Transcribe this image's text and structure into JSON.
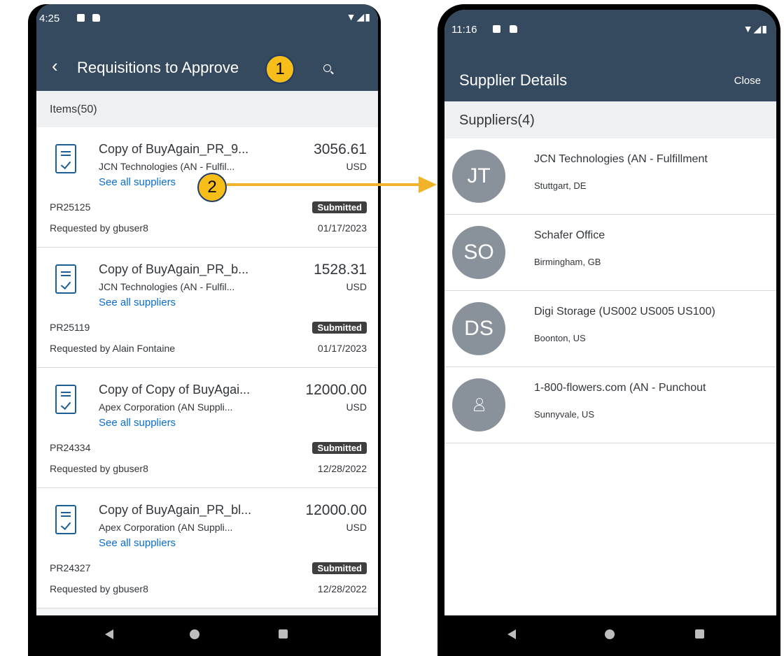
{
  "left_phone": {
    "status_time": "4:25",
    "title": "Requisitions to Approve",
    "items_count": "Items(50)",
    "items": [
      {
        "title": "Copy of BuyAgain_PR_9...",
        "supplier": "JCN Technologies (AN - Fulfil...",
        "link": "See all suppliers",
        "amount": "3056.61",
        "currency": "USD",
        "pr": "PR25125",
        "status": "Submitted",
        "requested_by": "Requested by gbuser8",
        "date": "01/17/2023"
      },
      {
        "title": "Copy of BuyAgain_PR_b...",
        "supplier": "JCN Technologies (AN - Fulfil...",
        "link": "See all suppliers",
        "amount": "1528.31",
        "currency": "USD",
        "pr": "PR25119",
        "status": "Submitted",
        "requested_by": "Requested by Alain Fontaine",
        "date": "01/17/2023"
      },
      {
        "title": "Copy of Copy of BuyAgai...",
        "supplier": "Apex Corporation (AN Suppli...",
        "link": "See all suppliers",
        "amount": "12000.00",
        "currency": "USD",
        "pr": "PR24334",
        "status": "Submitted",
        "requested_by": "Requested by gbuser8",
        "date": "12/28/2022"
      },
      {
        "title": "Copy of BuyAgain_PR_bl...",
        "supplier": "Apex Corporation (AN Suppli...",
        "link": "See all suppliers",
        "amount": "12000.00",
        "currency": "USD",
        "pr": "PR24327",
        "status": "Submitted",
        "requested_by": "Requested by gbuser8",
        "date": "12/28/2022"
      }
    ]
  },
  "right_phone": {
    "status_time": "11:16",
    "title": "Supplier Details",
    "close_label": "Close",
    "suppliers_count": "Suppliers(4)",
    "suppliers": [
      {
        "initials": "JT",
        "name": "JCN Technologies (AN - Fulfillment",
        "location": "Stuttgart, DE"
      },
      {
        "initials": "SO",
        "name": "Schafer Office",
        "location": "Birmingham, GB"
      },
      {
        "initials": "DS",
        "name": "Digi Storage (US002 US005 US100)",
        "location": "Boonton, US"
      },
      {
        "initials": "",
        "name": "1-800-flowers.com (AN - Punchout",
        "location": "Sunnyvale, US"
      }
    ]
  },
  "callouts": {
    "one": "1",
    "two": "2"
  },
  "colors": {
    "header": "#354a5f",
    "link": "#0a6ed1",
    "callout": "#f7be1a",
    "badge": "#3f3f3f",
    "avatar": "#89919a"
  }
}
